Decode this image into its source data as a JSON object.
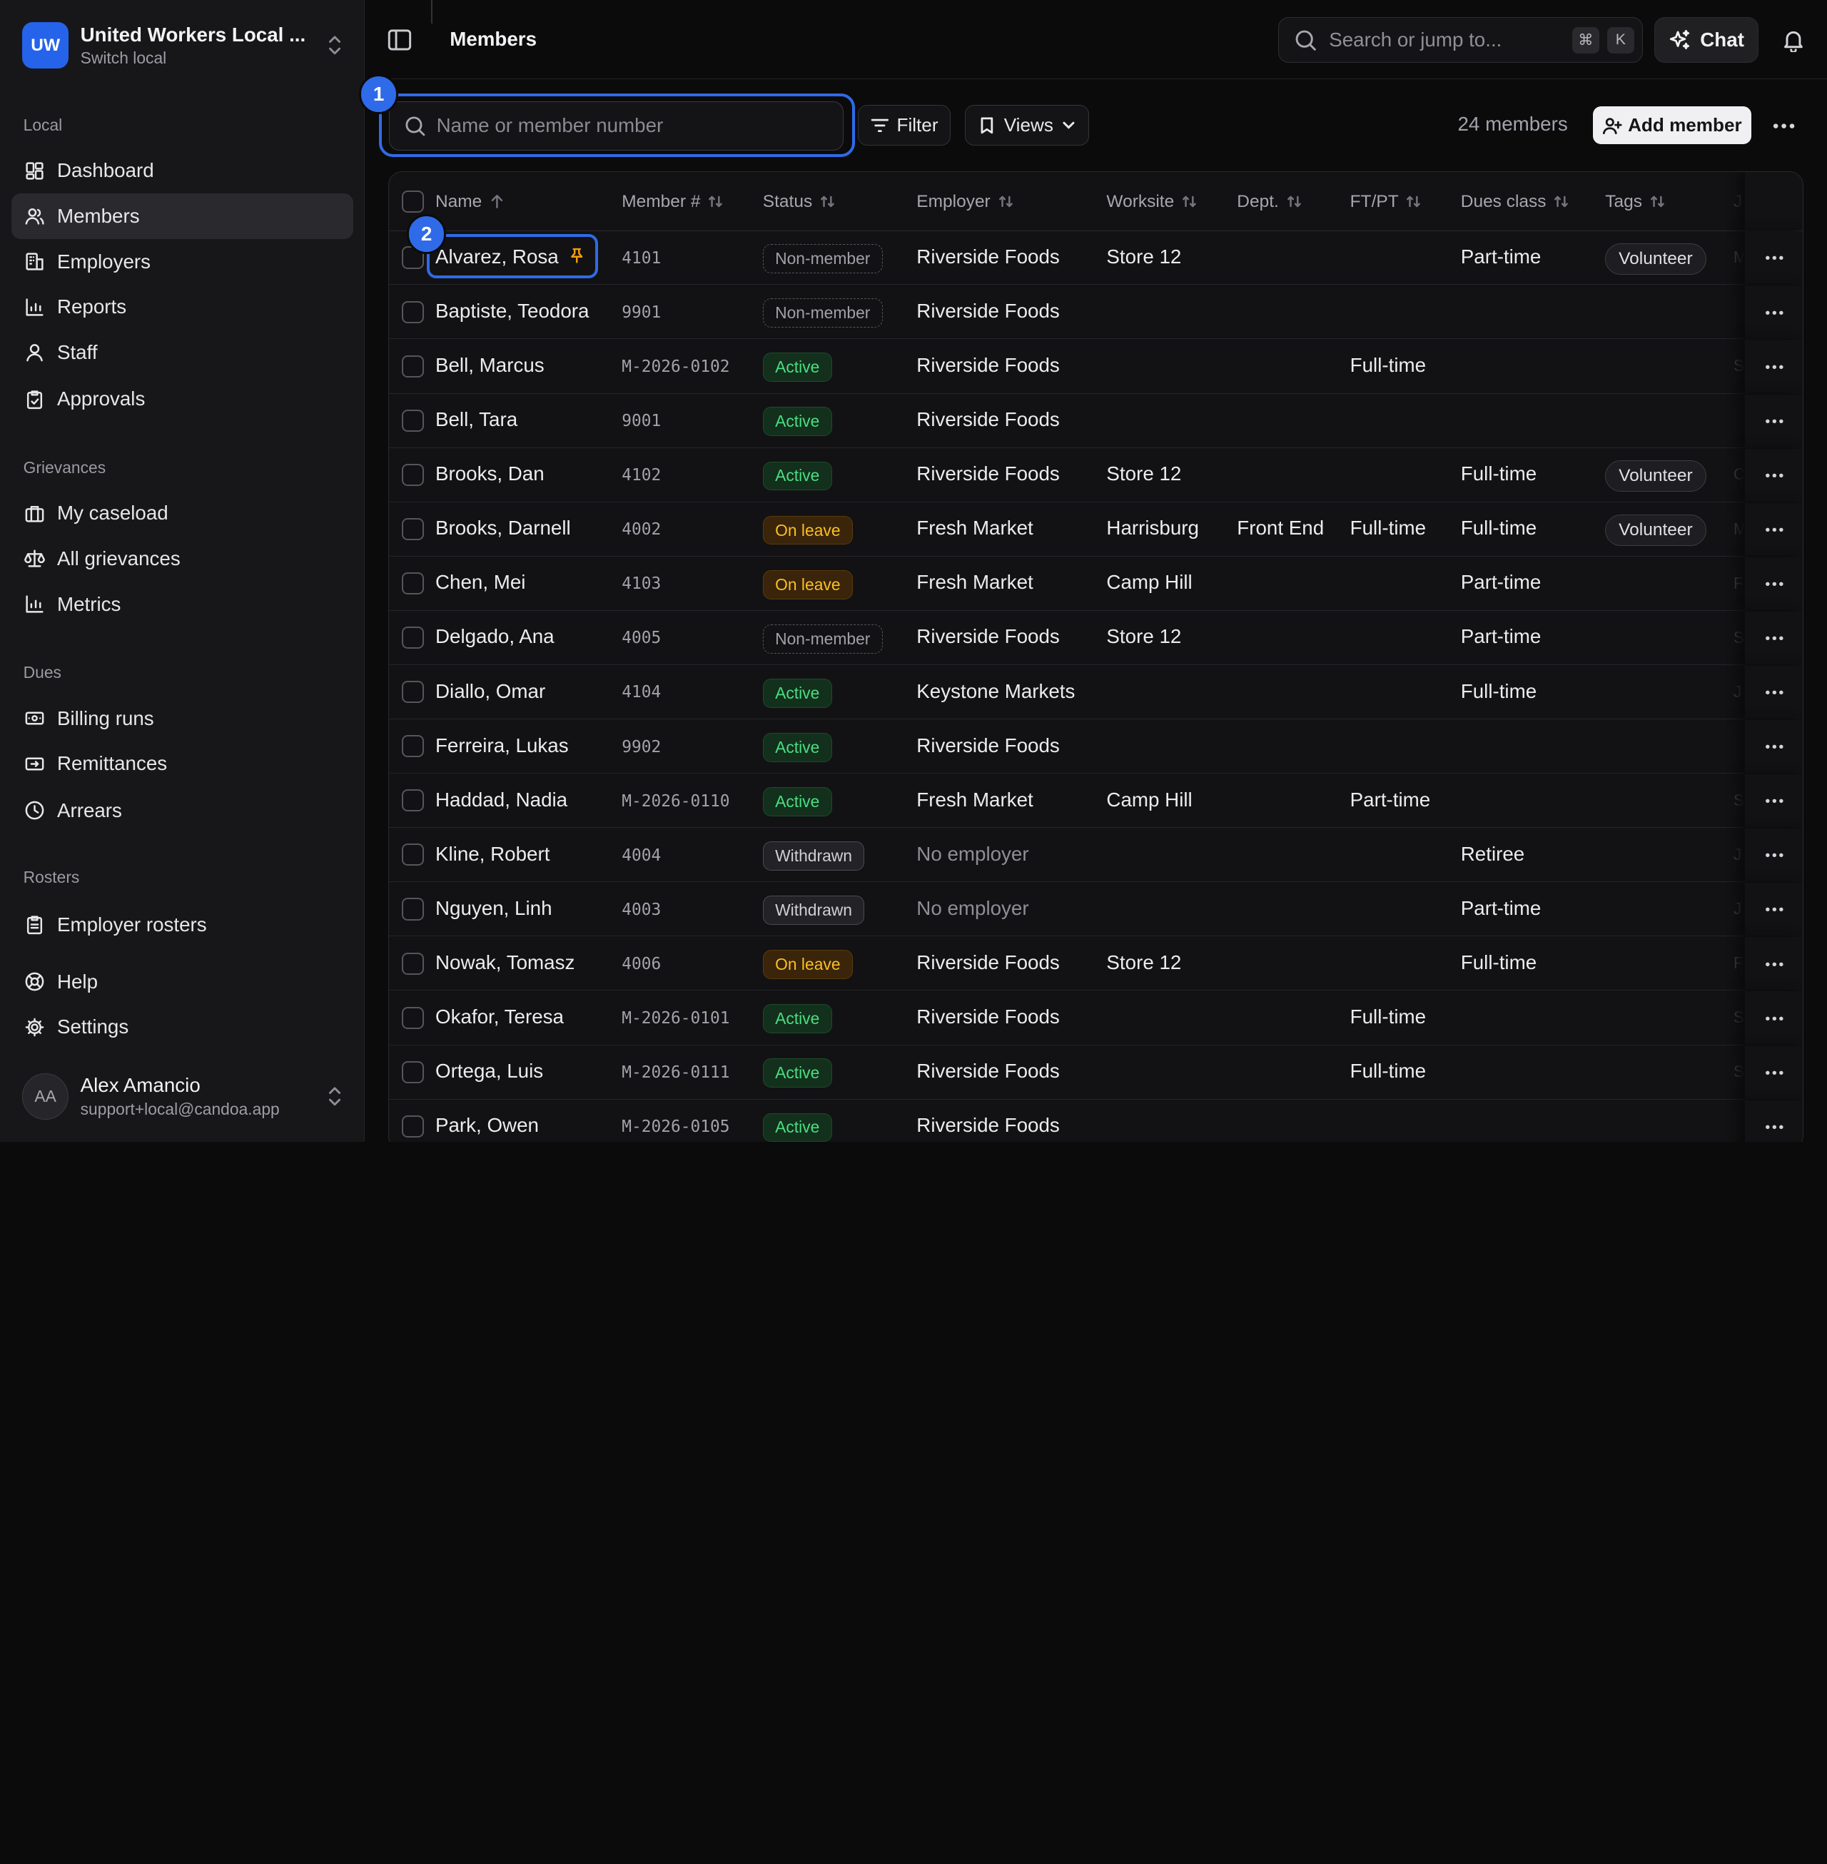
{
  "org": {
    "initials": "UW",
    "name": "United Workers Local ...",
    "switch_label": "Switch local"
  },
  "sidebar": {
    "sections": [
      {
        "label": "Local",
        "items": [
          {
            "label": "Dashboard",
            "icon": "dashboard-icon"
          },
          {
            "label": "Members",
            "icon": "users-icon",
            "active": true
          },
          {
            "label": "Employers",
            "icon": "building-icon"
          },
          {
            "label": "Reports",
            "icon": "bar-chart-icon"
          },
          {
            "label": "Staff",
            "icon": "person-icon"
          },
          {
            "label": "Approvals",
            "icon": "clipboard-check-icon"
          }
        ]
      },
      {
        "label": "Grievances",
        "items": [
          {
            "label": "My caseload",
            "icon": "briefcase-icon"
          },
          {
            "label": "All grievances",
            "icon": "scales-icon"
          },
          {
            "label": "Metrics",
            "icon": "bar-chart-icon"
          }
        ]
      },
      {
        "label": "Dues",
        "items": [
          {
            "label": "Billing runs",
            "icon": "banknote-icon"
          },
          {
            "label": "Remittances",
            "icon": "remittance-icon"
          },
          {
            "label": "Arrears",
            "icon": "clock-icon"
          }
        ]
      },
      {
        "label": "Rosters",
        "items": [
          {
            "label": "Employer rosters",
            "icon": "clipboard-list-icon"
          }
        ]
      }
    ],
    "footer_items": [
      {
        "label": "Help",
        "icon": "lifebuoy-icon"
      },
      {
        "label": "Settings",
        "icon": "gear-icon"
      }
    ],
    "user": {
      "initials": "AA",
      "name": "Alex Amancio",
      "email": "support+local@candoa.app"
    }
  },
  "topbar": {
    "title": "Members",
    "search_placeholder": "Search or jump to...",
    "kbd_1": "⌘",
    "kbd_2": "K",
    "chat_label": "Chat"
  },
  "toolbar": {
    "search_placeholder": "Name or member number",
    "filter_label": "Filter",
    "views_label": "Views",
    "member_count": "24 members",
    "add_label": "Add member"
  },
  "annotations": {
    "one": "1",
    "two": "2"
  },
  "table": {
    "columns": [
      {
        "label": "Name",
        "sort": "asc"
      },
      {
        "label": "Member #",
        "sort": "both"
      },
      {
        "label": "Status",
        "sort": "both"
      },
      {
        "label": "Employer",
        "sort": "both"
      },
      {
        "label": "Worksite",
        "sort": "both"
      },
      {
        "label": "Dept.",
        "sort": "both"
      },
      {
        "label": "FT/PT",
        "sort": "both"
      },
      {
        "label": "Dues class",
        "sort": "both"
      },
      {
        "label": "Tags",
        "sort": "both"
      },
      {
        "label": "J"
      }
    ],
    "rows": [
      {
        "name": "Alvarez, Rosa",
        "pinned": true,
        "member_no": "4101",
        "status": "Non-member",
        "status_kind": "non",
        "employer": "Riverside Foods",
        "worksite": "Store 12",
        "dept": "",
        "ftpt": "",
        "dues": "Part-time",
        "tag": "Volunteer",
        "trunc": "M"
      },
      {
        "name": "Baptiste, Teodora",
        "member_no": "9901",
        "status": "Non-member",
        "status_kind": "non",
        "employer": "Riverside Foods",
        "worksite": "",
        "dept": "",
        "ftpt": "",
        "dues": "",
        "tag": "",
        "trunc": ""
      },
      {
        "name": "Bell, Marcus",
        "member_no": "M-2026-0102",
        "status": "Active",
        "status_kind": "active",
        "employer": "Riverside Foods",
        "worksite": "",
        "dept": "",
        "ftpt": "Full-time",
        "dues": "",
        "tag": "",
        "trunc": "S"
      },
      {
        "name": "Bell, Tara",
        "member_no": "9001",
        "status": "Active",
        "status_kind": "active",
        "employer": "Riverside Foods",
        "worksite": "",
        "dept": "",
        "ftpt": "",
        "dues": "",
        "tag": "",
        "trunc": ""
      },
      {
        "name": "Brooks, Dan",
        "member_no": "4102",
        "status": "Active",
        "status_kind": "active",
        "employer": "Riverside Foods",
        "worksite": "Store 12",
        "dept": "",
        "ftpt": "",
        "dues": "Full-time",
        "tag": "Volunteer",
        "trunc": "C"
      },
      {
        "name": "Brooks, Darnell",
        "member_no": "4002",
        "status": "On leave",
        "status_kind": "leave",
        "employer": "Fresh Market",
        "worksite": "Harrisburg",
        "dept": "Front End",
        "ftpt": "Full-time",
        "dues": "Full-time",
        "tag": "Volunteer",
        "trunc": "M"
      },
      {
        "name": "Chen, Mei",
        "member_no": "4103",
        "status": "On leave",
        "status_kind": "leave",
        "employer": "Fresh Market",
        "worksite": "Camp Hill",
        "dept": "",
        "ftpt": "",
        "dues": "Part-time",
        "tag": "",
        "trunc": "F"
      },
      {
        "name": "Delgado, Ana",
        "member_no": "4005",
        "status": "Non-member",
        "status_kind": "non",
        "employer": "Riverside Foods",
        "worksite": "Store 12",
        "dept": "",
        "ftpt": "",
        "dues": "Part-time",
        "tag": "",
        "trunc": "S"
      },
      {
        "name": "Diallo, Omar",
        "member_no": "4104",
        "status": "Active",
        "status_kind": "active",
        "employer": "Keystone Markets",
        "worksite": "",
        "dept": "",
        "ftpt": "",
        "dues": "Full-time",
        "tag": "",
        "trunc": "J"
      },
      {
        "name": "Ferreira, Lukas",
        "member_no": "9902",
        "status": "Active",
        "status_kind": "active",
        "employer": "Riverside Foods",
        "worksite": "",
        "dept": "",
        "ftpt": "",
        "dues": "",
        "tag": "",
        "trunc": ""
      },
      {
        "name": "Haddad, Nadia",
        "member_no": "M-2026-0110",
        "status": "Active",
        "status_kind": "active",
        "employer": "Fresh Market",
        "worksite": "Camp Hill",
        "dept": "",
        "ftpt": "Part-time",
        "dues": "",
        "tag": "",
        "trunc": "S"
      },
      {
        "name": "Kline, Robert",
        "member_no": "4004",
        "status": "Withdrawn",
        "status_kind": "withdrawn",
        "employer": "No employer",
        "employer_muted": true,
        "worksite": "",
        "dept": "",
        "ftpt": "",
        "dues": "Retiree",
        "tag": "",
        "trunc": "J"
      },
      {
        "name": "Nguyen, Linh",
        "member_no": "4003",
        "status": "Withdrawn",
        "status_kind": "withdrawn",
        "employer": "No employer",
        "employer_muted": true,
        "worksite": "",
        "dept": "",
        "ftpt": "",
        "dues": "Part-time",
        "tag": "",
        "trunc": "J"
      },
      {
        "name": "Nowak, Tomasz",
        "member_no": "4006",
        "status": "On leave",
        "status_kind": "leave",
        "employer": "Riverside Foods",
        "worksite": "Store 12",
        "dept": "",
        "ftpt": "",
        "dues": "Full-time",
        "tag": "",
        "trunc": "F"
      },
      {
        "name": "Okafor, Teresa",
        "member_no": "M-2026-0101",
        "status": "Active",
        "status_kind": "active",
        "employer": "Riverside Foods",
        "worksite": "",
        "dept": "",
        "ftpt": "Full-time",
        "dues": "",
        "tag": "",
        "trunc": "S"
      },
      {
        "name": "Ortega, Luis",
        "member_no": "M-2026-0111",
        "status": "Active",
        "status_kind": "active",
        "employer": "Riverside Foods",
        "worksite": "",
        "dept": "",
        "ftpt": "Full-time",
        "dues": "",
        "tag": "",
        "trunc": "S"
      },
      {
        "name": "Park, Owen",
        "member_no": "M-2026-0105",
        "status": "Active",
        "status_kind": "active",
        "employer": "Riverside Foods",
        "worksite": "",
        "dept": "",
        "ftpt": "",
        "dues": "",
        "tag": "",
        "trunc": ""
      }
    ]
  }
}
